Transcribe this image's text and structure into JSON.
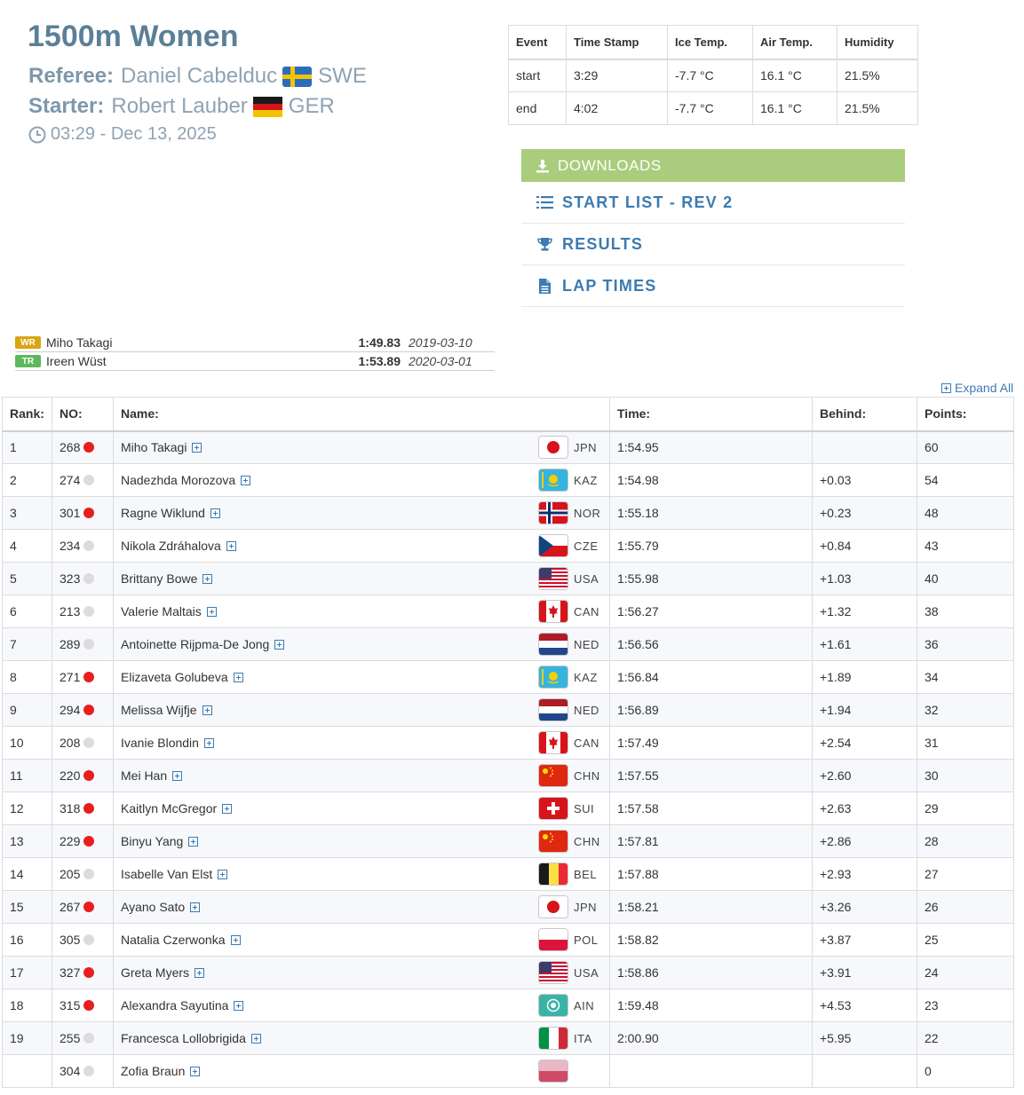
{
  "event": {
    "title": "1500m Women",
    "referee_label": "Referee:",
    "referee_name": "Daniel Cabelduc",
    "referee_country": "SWE",
    "starter_label": "Starter:",
    "starter_name": "Robert Lauber",
    "starter_country": "GER",
    "datetime": "03:29 - Dec 13, 2025"
  },
  "conditions": {
    "headers": [
      "Event",
      "Time Stamp",
      "Ice Temp.",
      "Air Temp.",
      "Humidity"
    ],
    "rows": [
      [
        "start",
        "3:29",
        "-7.7 °C",
        "16.1 °C",
        "21.5%"
      ],
      [
        "end",
        "4:02",
        "-7.7 °C",
        "16.1 °C",
        "21.5%"
      ]
    ]
  },
  "downloads": {
    "header": "DOWNLOADS",
    "items": [
      {
        "label": "START LIST - REV 2",
        "icon": "list-icon"
      },
      {
        "label": "RESULTS",
        "icon": "trophy-icon"
      },
      {
        "label": "LAP TIMES",
        "icon": "document-icon"
      }
    ]
  },
  "records": [
    {
      "badge": "WR",
      "color": "#d9a514",
      "name": "Miho Takagi",
      "time": "1:49.83",
      "date": "2019-03-10"
    },
    {
      "badge": "TR",
      "color": "#5cb85c",
      "name": "Ireen Wüst",
      "time": "1:53.89",
      "date": "2020-03-01"
    }
  ],
  "expand_all": "Expand All",
  "results": {
    "headers": [
      "Rank:",
      "NO:",
      "Name:",
      "Time:",
      "Behind:",
      "Points:"
    ],
    "rows": [
      {
        "rank": "1",
        "no": "268",
        "dot": "red",
        "name": "Miho Takagi",
        "country": "JPN",
        "time": "1:54.95",
        "behind": "",
        "points": "60"
      },
      {
        "rank": "2",
        "no": "274",
        "dot": "grey",
        "name": "Nadezhda Morozova",
        "country": "KAZ",
        "time": "1:54.98",
        "behind": "+0.03",
        "points": "54"
      },
      {
        "rank": "3",
        "no": "301",
        "dot": "red",
        "name": "Ragne Wiklund",
        "country": "NOR",
        "time": "1:55.18",
        "behind": "+0.23",
        "points": "48"
      },
      {
        "rank": "4",
        "no": "234",
        "dot": "grey",
        "name": "Nikola Zdráhalova",
        "country": "CZE",
        "time": "1:55.79",
        "behind": "+0.84",
        "points": "43"
      },
      {
        "rank": "5",
        "no": "323",
        "dot": "grey",
        "name": "Brittany Bowe",
        "country": "USA",
        "time": "1:55.98",
        "behind": "+1.03",
        "points": "40"
      },
      {
        "rank": "6",
        "no": "213",
        "dot": "grey",
        "name": "Valerie Maltais",
        "country": "CAN",
        "time": "1:56.27",
        "behind": "+1.32",
        "points": "38"
      },
      {
        "rank": "7",
        "no": "289",
        "dot": "grey",
        "name": "Antoinette Rijpma-De Jong",
        "country": "NED",
        "time": "1:56.56",
        "behind": "+1.61",
        "points": "36"
      },
      {
        "rank": "8",
        "no": "271",
        "dot": "red",
        "name": "Elizaveta Golubeva",
        "country": "KAZ",
        "time": "1:56.84",
        "behind": "+1.89",
        "points": "34"
      },
      {
        "rank": "9",
        "no": "294",
        "dot": "red",
        "name": "Melissa Wijfje",
        "country": "NED",
        "time": "1:56.89",
        "behind": "+1.94",
        "points": "32"
      },
      {
        "rank": "10",
        "no": "208",
        "dot": "grey",
        "name": "Ivanie Blondin",
        "country": "CAN",
        "time": "1:57.49",
        "behind": "+2.54",
        "points": "31"
      },
      {
        "rank": "11",
        "no": "220",
        "dot": "red",
        "name": "Mei Han",
        "country": "CHN",
        "time": "1:57.55",
        "behind": "+2.60",
        "points": "30"
      },
      {
        "rank": "12",
        "no": "318",
        "dot": "red",
        "name": "Kaitlyn McGregor",
        "country": "SUI",
        "time": "1:57.58",
        "behind": "+2.63",
        "points": "29"
      },
      {
        "rank": "13",
        "no": "229",
        "dot": "red",
        "name": "Binyu Yang",
        "country": "CHN",
        "time": "1:57.81",
        "behind": "+2.86",
        "points": "28"
      },
      {
        "rank": "14",
        "no": "205",
        "dot": "grey",
        "name": "Isabelle Van Elst",
        "country": "BEL",
        "time": "1:57.88",
        "behind": "+2.93",
        "points": "27"
      },
      {
        "rank": "15",
        "no": "267",
        "dot": "red",
        "name": "Ayano Sato",
        "country": "JPN",
        "time": "1:58.21",
        "behind": "+3.26",
        "points": "26"
      },
      {
        "rank": "16",
        "no": "305",
        "dot": "grey",
        "name": "Natalia Czerwonka",
        "country": "POL",
        "time": "1:58.82",
        "behind": "+3.87",
        "points": "25"
      },
      {
        "rank": "17",
        "no": "327",
        "dot": "red",
        "name": "Greta Myers",
        "country": "USA",
        "time": "1:58.86",
        "behind": "+3.91",
        "points": "24"
      },
      {
        "rank": "18",
        "no": "315",
        "dot": "red",
        "name": "Alexandra Sayutina",
        "country": "AIN",
        "time": "1:59.48",
        "behind": "+4.53",
        "points": "23"
      },
      {
        "rank": "19",
        "no": "255",
        "dot": "grey",
        "name": "Francesca Lollobrigida",
        "country": "ITA",
        "time": "2:00.90",
        "behind": "+5.95",
        "points": "22"
      },
      {
        "rank": "",
        "no": "304",
        "dot": "grey",
        "name": "Zofia Braun",
        "country": "",
        "time": "",
        "behind": "",
        "points": "0"
      }
    ]
  },
  "colors": {
    "title": "#5b7f98",
    "link": "#3c7bb1",
    "downloads_bar": "#a9cd7c",
    "red_dot": "#e81e1e"
  }
}
